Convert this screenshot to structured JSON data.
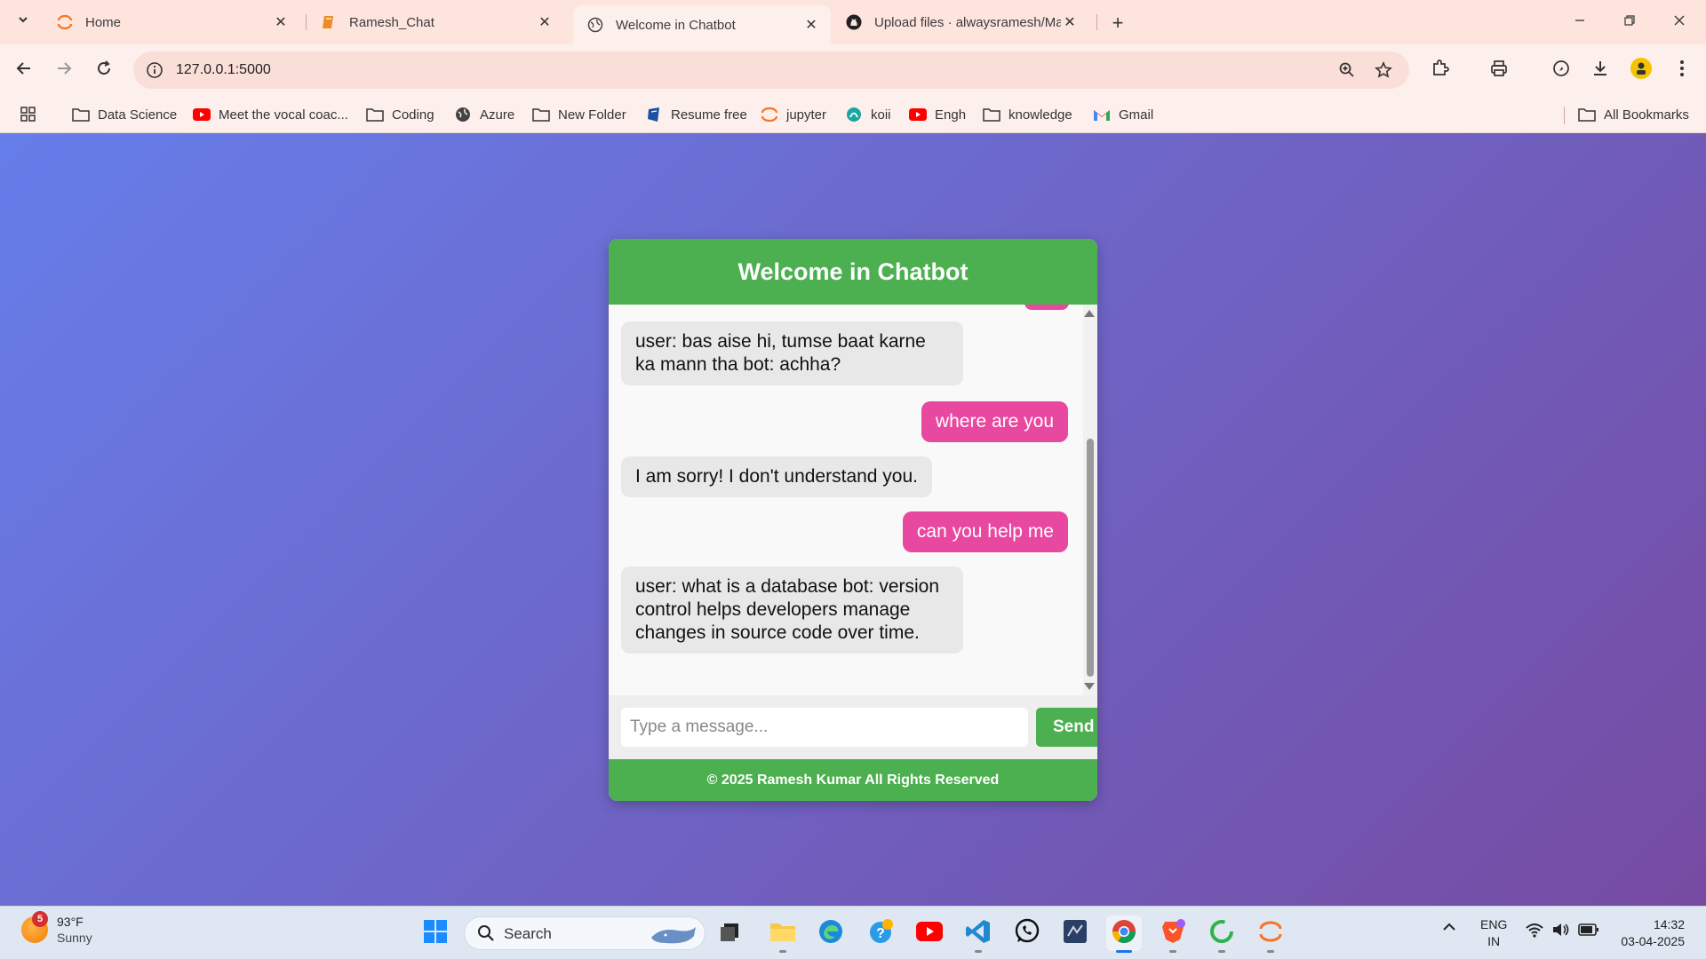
{
  "browser": {
    "tabs": [
      {
        "title": "Home"
      },
      {
        "title": "Ramesh_Chat"
      },
      {
        "title": "Welcome in Chatbot"
      },
      {
        "title": "Upload files · alwaysramesh/Ma"
      }
    ],
    "url": "127.0.0.1:5000",
    "bookmarks": [
      {
        "label": "Data Science"
      },
      {
        "label": "Meet the vocal coac..."
      },
      {
        "label": "Coding"
      },
      {
        "label": "Azure"
      },
      {
        "label": "New Folder"
      },
      {
        "label": "Resume free"
      },
      {
        "label": "jupyter"
      },
      {
        "label": "koii"
      },
      {
        "label": "Engh"
      },
      {
        "label": "knowledge"
      },
      {
        "label": "Gmail"
      }
    ],
    "all_bookmarks": "All Bookmarks"
  },
  "chat": {
    "title": "Welcome in Chatbot",
    "messages": [
      {
        "sender": "bot",
        "text": "user: bas aise hi, tumse baat karne ka mann tha bot: achha?"
      },
      {
        "sender": "user",
        "text": "where are you"
      },
      {
        "sender": "bot",
        "text": "I am sorry! I don't understand you."
      },
      {
        "sender": "user",
        "text": "can you help me"
      },
      {
        "sender": "bot",
        "text": "user: what is a database bot: version control helps developers manage changes in source code over time."
      }
    ],
    "input_placeholder": "Type a message...",
    "send_label": "Send",
    "footer": "© 2025 Ramesh Kumar All Rights Reserved",
    "colors": {
      "header": "#4caf50",
      "user_bubble": "#e8489f",
      "bot_bubble": "#e8e8e8"
    }
  },
  "taskbar": {
    "weather": {
      "temp": "93°F",
      "condition": "Sunny",
      "badge": "5"
    },
    "search_label": "Search",
    "language": {
      "line1": "ENG",
      "line2": "IN"
    },
    "clock": {
      "time": "14:32",
      "date": "03-04-2025"
    }
  }
}
